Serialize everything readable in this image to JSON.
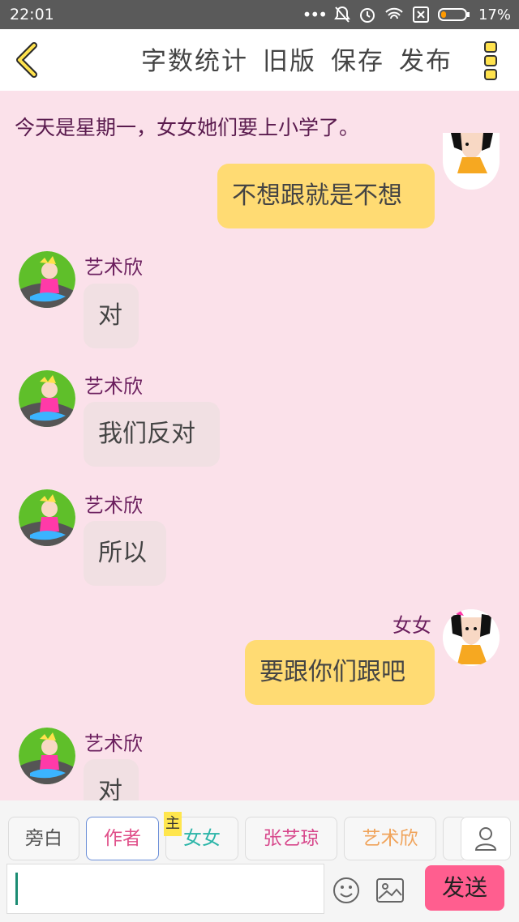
{
  "statusbar": {
    "time": "22:01",
    "battery": "17%"
  },
  "toolbar": {
    "word_count": "字数统计",
    "old_version": "旧版",
    "save": "保存",
    "publish": "发布"
  },
  "narration": "今天是星期一，女女她们要上小学了。",
  "messages": [
    {
      "side": "right",
      "name": "",
      "text": "不想跟就是不想"
    },
    {
      "side": "left",
      "name": "艺术欣",
      "text": "对"
    },
    {
      "side": "left",
      "name": "艺术欣",
      "text": "我们反对"
    },
    {
      "side": "left",
      "name": "艺术欣",
      "text": "所以"
    },
    {
      "side": "right",
      "name": "女女",
      "text": "要跟你们跟吧"
    },
    {
      "side": "left",
      "name": "艺术欣",
      "text": "对"
    }
  ],
  "roles": [
    {
      "label": "旁白",
      "color": "#555555"
    },
    {
      "label": "作者",
      "color": "#e0508a"
    },
    {
      "label": "女女",
      "color": "#2bb5a8"
    },
    {
      "label": "张艺琼",
      "color": "#d7478b"
    },
    {
      "label": "艺术欣",
      "color": "#f0a35a"
    }
  ],
  "host_badge": "主",
  "send_label": "发送",
  "colors": {
    "background": "#fbe1ea",
    "right_bubble": "#ffdb73",
    "left_bubble": "#f1e0e3",
    "send": "#ff5e8f"
  }
}
